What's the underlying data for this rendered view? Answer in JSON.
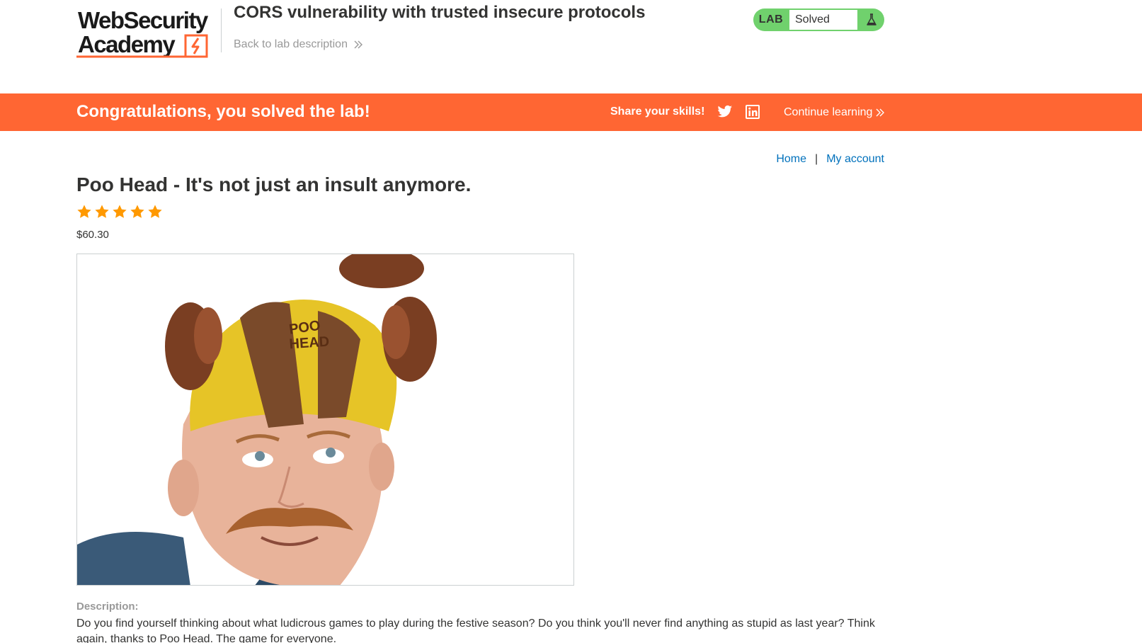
{
  "header": {
    "logo_alt": "Web Security Academy",
    "lab_title": "CORS vulnerability with trusted insecure protocols",
    "back_link": "Back to lab description",
    "lab_badge": {
      "label": "LAB",
      "status": "Solved"
    }
  },
  "banner": {
    "message": "Congratulations, you solved the lab!",
    "share": "Share your skills!",
    "continue": "Continue learning"
  },
  "nav": {
    "home": "Home",
    "separator": "|",
    "my_account": "My account"
  },
  "product": {
    "title": "Poo Head - It's not just an insult anymore.",
    "rating": 5,
    "rating_max": 5,
    "price": "$60.30",
    "description_label": "Description:",
    "description": "Do you find yourself thinking about what ludicrous games to play during the festive season? Do you think you'll never find anything as stupid as last year? Think again, thanks to Poo Head. The game for everyone."
  },
  "icons": {
    "twitter": "twitter-icon",
    "linkedin": "linkedin-icon",
    "flask": "flask-icon",
    "star": "star-icon",
    "chevron": "double-chevron-right-icon"
  },
  "colors": {
    "brand_orange": "#ff6633",
    "solved_green": "#70d16d",
    "link_blue": "#0071bc",
    "star_orange": "#ff9900",
    "text_dark": "#333332",
    "text_muted": "#999999"
  }
}
